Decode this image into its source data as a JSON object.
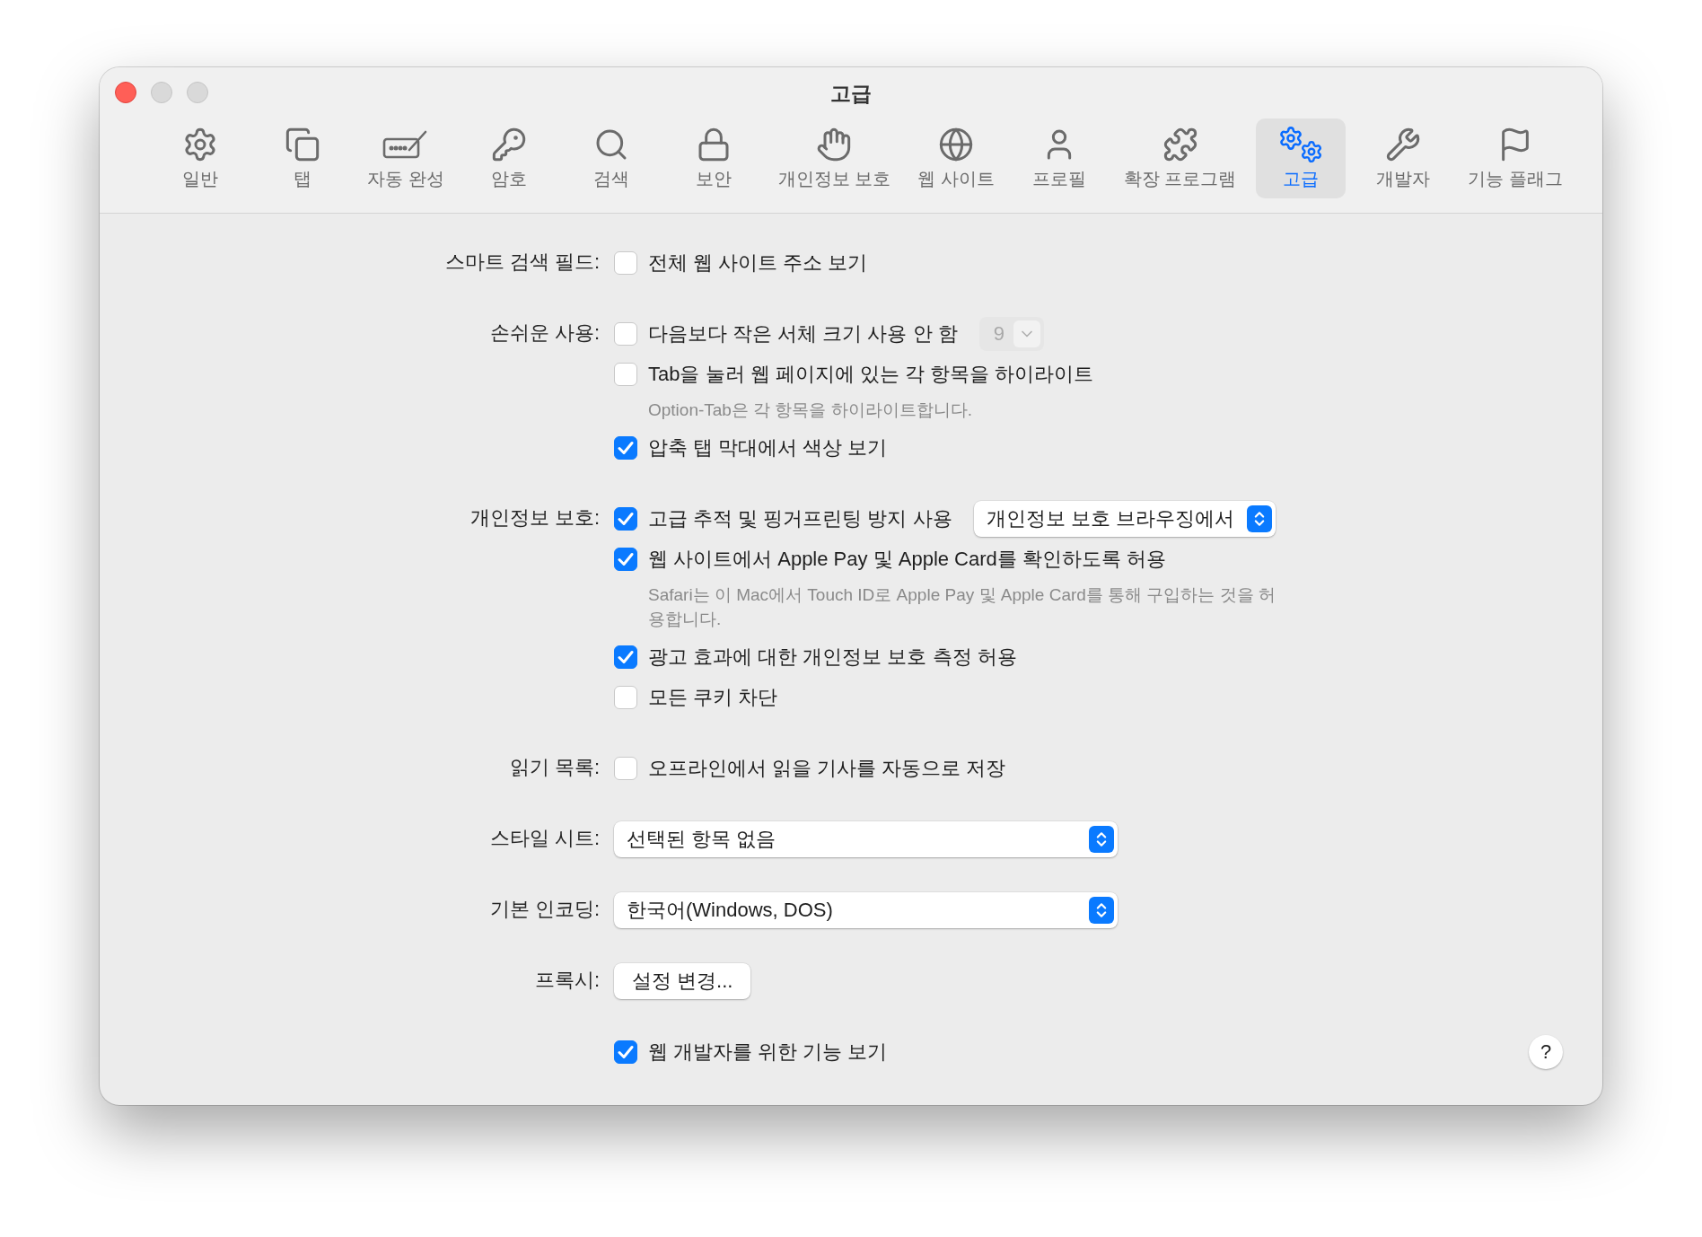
{
  "window": {
    "title": "고급"
  },
  "toolbar": [
    {
      "label": "일반",
      "selected": false
    },
    {
      "label": "탭",
      "selected": false
    },
    {
      "label": "자동 완성",
      "selected": false
    },
    {
      "label": "암호",
      "selected": false
    },
    {
      "label": "검색",
      "selected": false
    },
    {
      "label": "보안",
      "selected": false
    },
    {
      "label": "개인정보 보호",
      "selected": false
    },
    {
      "label": "웹 사이트",
      "selected": false
    },
    {
      "label": "프로필",
      "selected": false
    },
    {
      "label": "확장 프로그램",
      "selected": false
    },
    {
      "label": "고급",
      "selected": true
    },
    {
      "label": "개발자",
      "selected": false
    },
    {
      "label": "기능 플래그",
      "selected": false
    }
  ],
  "sections": [
    {
      "label": "스마트 검색 필드:",
      "rows": [
        {
          "kind": "checkbox",
          "text": "전체 웹 사이트 주소 보기",
          "checked": false
        }
      ]
    },
    {
      "label": "손쉬운 사용:",
      "rows": [
        {
          "kind": "checkbox",
          "text": "다음보다 작은 서체 크기 사용 안 함",
          "checked": false,
          "size_menu": {
            "value": "9",
            "disabled": true
          }
        },
        {
          "kind": "checkbox",
          "text": "Tab을 눌러 웹 페이지에 있는 각 항목을 하이라이트",
          "checked": false
        },
        {
          "kind": "note",
          "text": "Option-Tab은 각 항목을 하이라이트합니다."
        },
        {
          "kind": "checkbox",
          "text": "압축 탭 막대에서 색상 보기",
          "checked": true
        }
      ]
    },
    {
      "label": "개인정보 보호:",
      "rows": [
        {
          "kind": "checkbox",
          "text": "고급 추적 및 핑거프린팅 방지 사용",
          "checked": true,
          "popup": {
            "value": "개인정보 보호 브라우징에서"
          }
        },
        {
          "kind": "checkbox",
          "text": "웹 사이트에서 Apple Pay 및 Apple Card를 확인하도록 허용",
          "checked": true
        },
        {
          "kind": "note",
          "text": "Safari는 이 Mac에서 Touch ID로 Apple Pay 및 Apple Card를 통해 구입하는 것을 허용합니다."
        },
        {
          "kind": "checkbox",
          "text": "광고 효과에 대한 개인정보 보호 측정 허용",
          "checked": true
        },
        {
          "kind": "checkbox",
          "text": "모든 쿠키 차단",
          "checked": false
        }
      ]
    },
    {
      "label": "읽기 목록:",
      "rows": [
        {
          "kind": "checkbox",
          "text": "오프라인에서 읽을 기사를 자동으로 저장",
          "checked": false
        }
      ]
    },
    {
      "label": "스타일 시트:",
      "rows": [
        {
          "kind": "popup",
          "text": "선택된 항목 없음"
        }
      ]
    },
    {
      "label": "기본 인코딩:",
      "rows": [
        {
          "kind": "popup",
          "text": "한국어(Windows, DOS)"
        }
      ]
    },
    {
      "label": "프록시:",
      "rows": [
        {
          "kind": "button",
          "text": "설정 변경..."
        }
      ]
    },
    {
      "rows": [
        {
          "kind": "checkbox",
          "text": "웹 개발자를 위한 기능 보기",
          "checked": true
        }
      ]
    }
  ],
  "help_button": "?"
}
